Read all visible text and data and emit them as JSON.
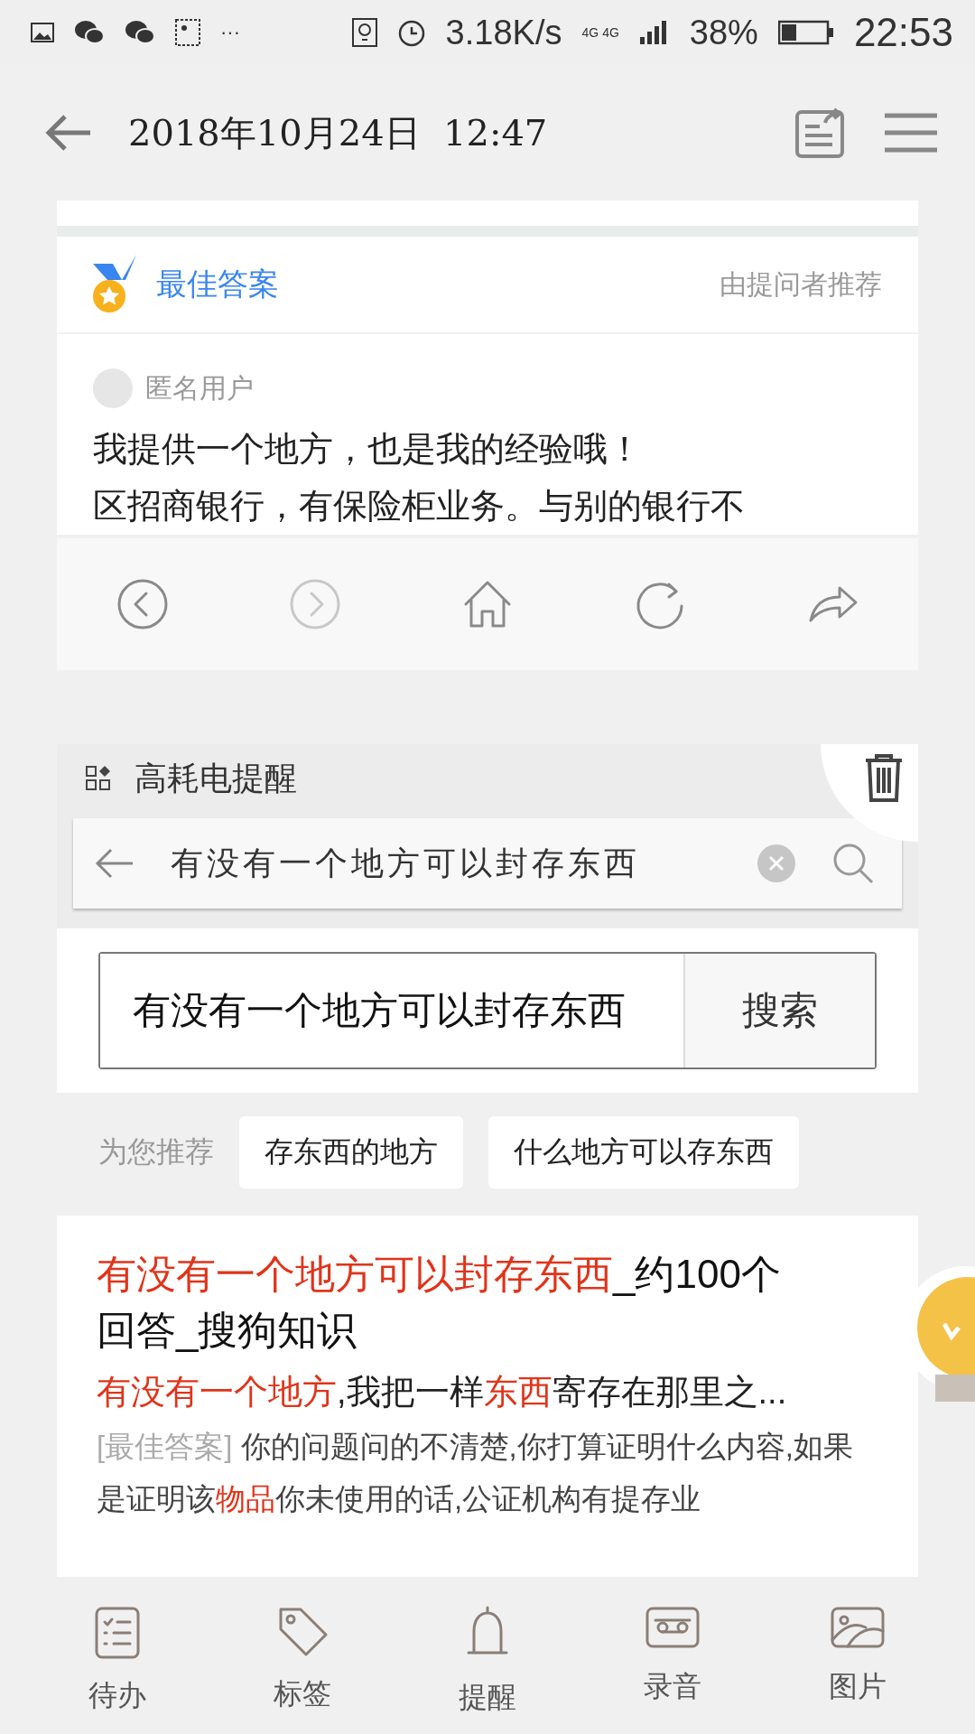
{
  "status_bar": {
    "more": "···",
    "speed": "3.18K/s",
    "network": "4G",
    "network_2": "4G",
    "battery_text": "38%",
    "time": "22:53"
  },
  "header": {
    "title": "2018年10月24日  12:47"
  },
  "best_answer": {
    "label": "最佳答案",
    "recommended_by": "由提问者推荐",
    "user": "匿名用户",
    "lines": [
      "我提供一个地方，也是我的经验哦！",
      "区招商银行，有保险柜业务。与别的银行不"
    ]
  },
  "browser_nav": [
    {
      "kind": "back",
      "disabled": false
    },
    {
      "kind": "forward",
      "disabled": true
    },
    {
      "kind": "home",
      "disabled": false
    },
    {
      "kind": "refresh",
      "disabled": false
    },
    {
      "kind": "share",
      "disabled": false
    }
  ],
  "notice": {
    "title": "高耗电提醒"
  },
  "search_bar": {
    "query": "有没有一个地方可以封存东西"
  },
  "search_box": {
    "value": "有没有一个地方可以封存东西",
    "button": "搜索"
  },
  "recommend": {
    "label": "为您推荐",
    "chips": [
      "存东西的地方",
      "什么地方可以存东西"
    ]
  },
  "result": {
    "title": [
      {
        "text": "有没有一个地方可以封存东西",
        "highlight": true
      },
      {
        "text": "_约100个回答_搜狗知识",
        "highlight": false
      }
    ],
    "snippet": [
      {
        "text": "有没有一个地方",
        "highlight": true
      },
      {
        "text": ",我把一样",
        "highlight": false
      },
      {
        "text": "东西",
        "highlight": true
      },
      {
        "text": "寄存在那里之...",
        "highlight": false
      }
    ],
    "answer_tag": "[最佳答案]",
    "answer": [
      {
        "text": "你的问题问的不清楚,你打算证明什么内容,如果是证明该",
        "highlight": false
      },
      {
        "text": "物品",
        "highlight": true
      },
      {
        "text": "你未使用的话,公证机构有提存业",
        "highlight": false
      }
    ]
  },
  "toolbar": [
    {
      "kind": "todo",
      "label": "待办"
    },
    {
      "kind": "tag",
      "label": "标签"
    },
    {
      "kind": "reminder",
      "label": "提醒"
    },
    {
      "kind": "recording",
      "label": "录音"
    },
    {
      "kind": "picture",
      "label": "图片"
    }
  ]
}
